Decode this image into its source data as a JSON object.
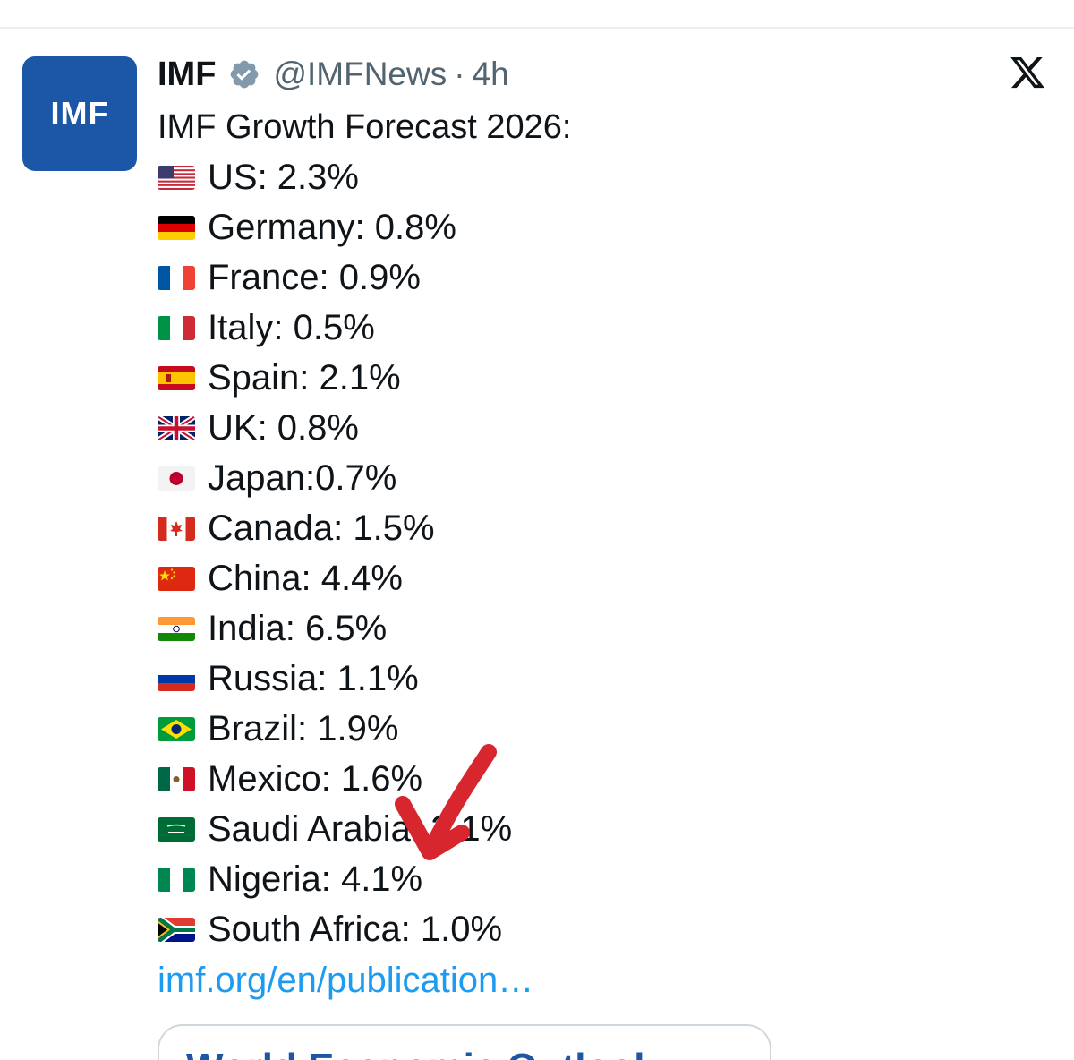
{
  "tweet": {
    "author": {
      "avatar_text": "IMF",
      "name": "IMF",
      "handle": "@IMFNews",
      "separator": "·",
      "time": "4h",
      "verified": true
    },
    "title": "IMF Growth Forecast 2026:",
    "rows": [
      {
        "flag": "us-flag",
        "text": "US: 2.3%"
      },
      {
        "flag": "germany-flag",
        "text": "Germany: 0.8%"
      },
      {
        "flag": "france-flag",
        "text": "France: 0.9%"
      },
      {
        "flag": "italy-flag",
        "text": "Italy: 0.5%"
      },
      {
        "flag": "spain-flag",
        "text": "Spain: 2.1%"
      },
      {
        "flag": "uk-flag",
        "text": "UK: 0.8%"
      },
      {
        "flag": "japan-flag",
        "text": "Japan:0.7%"
      },
      {
        "flag": "canada-flag",
        "text": "Canada: 1.5%"
      },
      {
        "flag": "china-flag",
        "text": "China: 4.4%"
      },
      {
        "flag": "india-flag",
        "text": "India: 6.5%"
      },
      {
        "flag": "russia-flag",
        "text": "Russia: 1.1%"
      },
      {
        "flag": "brazil-flag",
        "text": "Brazil: 1.9%"
      },
      {
        "flag": "mexico-flag",
        "text": "Mexico: 1.6%"
      },
      {
        "flag": "saudi-arabia-flag",
        "text": "Saudi Arabia: 2.1%"
      },
      {
        "flag": "nigeria-flag",
        "text": "Nigeria: 4.1%"
      },
      {
        "flag": "south-africa-flag",
        "text": "South Africa: 1.0%"
      }
    ],
    "link_text": "imf.org/en/publication…",
    "card_title": "World Economic Outlook"
  },
  "icons": {
    "close": "x-logo-icon",
    "verified": "verified-badge-icon",
    "annotation": "red-arrow-annotation"
  },
  "colors": {
    "avatar_bg": "#1c56a6",
    "link": "#1d9bf0",
    "muted": "#536471",
    "annotation": "#d8262e"
  }
}
